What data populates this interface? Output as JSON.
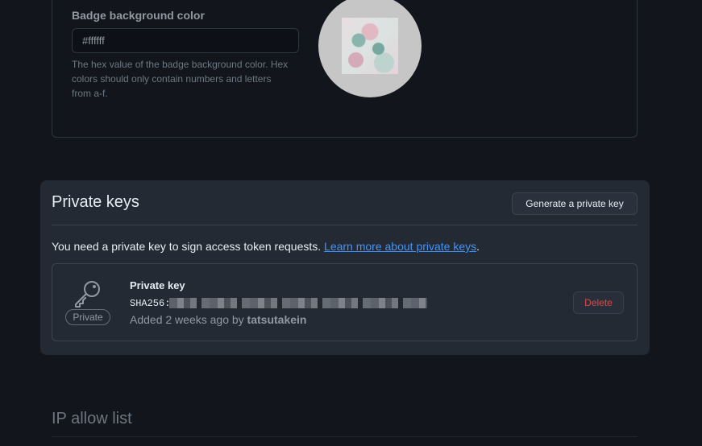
{
  "badge": {
    "label": "Badge background color",
    "value": "#ffffff",
    "help": "The hex value of the badge background color. Hex colors should only contain numbers and letters from a-f."
  },
  "private_keys": {
    "title": "Private keys",
    "generate_label": "Generate a private key",
    "intro_text": "You need a private key to sign access token requests. ",
    "intro_link": "Learn more about private keys",
    "intro_end": ".",
    "keys": [
      {
        "name": "Private key",
        "sha_prefix": "SHA256:",
        "added_prefix": "Added 2 weeks ago by ",
        "added_by": "tatsutakein",
        "badge": "Private",
        "delete_label": "Delete",
        "icon": "key-icon"
      }
    ]
  },
  "ip_allow_list": {
    "title": "IP allow list"
  },
  "colors": {
    "background": "#12161c",
    "panel": "#232a33",
    "link": "#4493f8",
    "danger": "#f85149"
  }
}
